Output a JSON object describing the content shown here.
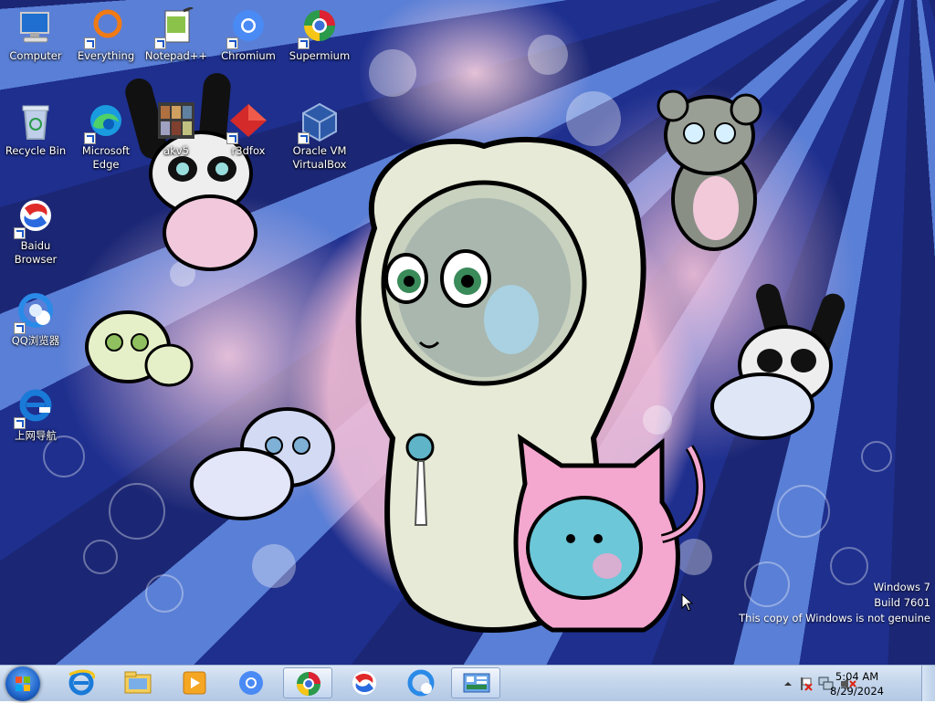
{
  "desktop_icons": [
    {
      "label": "Computer",
      "icon": "computer-icon",
      "shortcut": false
    },
    {
      "label": "Everything",
      "icon": "everything-icon",
      "shortcut": true
    },
    {
      "label": "Notepad++",
      "icon": "notepadpp-icon",
      "shortcut": true
    },
    {
      "label": "Chromium",
      "icon": "chromium-icon",
      "shortcut": true
    },
    {
      "label": "Supermium",
      "icon": "supermium-icon",
      "shortcut": true
    },
    {
      "label": "Recycle Bin",
      "icon": "recycle-bin-icon",
      "shortcut": false
    },
    {
      "label": "Microsoft Edge",
      "icon": "edge-icon",
      "shortcut": true
    },
    {
      "label": "akv5",
      "icon": "akv5-icon",
      "shortcut": false
    },
    {
      "label": "r3dfox",
      "icon": "r3dfox-icon",
      "shortcut": true
    },
    {
      "label": "Oracle VM VirtualBox",
      "icon": "virtualbox-icon",
      "shortcut": true
    },
    {
      "label": "Baidu Browser",
      "icon": "baidu-browser-icon",
      "shortcut": true
    },
    {
      "label": "QQ浏览器",
      "icon": "qq-browser-icon",
      "shortcut": true
    },
    {
      "label": "上网导航",
      "icon": "ie-navigation-icon",
      "shortcut": true
    }
  ],
  "watermark": {
    "line1": "Windows 7",
    "line2": "Build 7601",
    "line3": "This copy of Windows is not genuine"
  },
  "taskbar": {
    "items": [
      "internet-explorer-icon",
      "explorer-folder-icon",
      "media-player-icon",
      "chromium-icon",
      "supermium-icon",
      "baidu-browser-icon",
      "qq-browser-icon",
      "control-panel-icon"
    ],
    "active": [
      "supermium-icon",
      "control-panel-icon"
    ]
  },
  "tray": {
    "icons": [
      "show-hidden-icons-arrow",
      "action-center-flag-icon",
      "network-icon",
      "volume-muted-icon"
    ],
    "time": "5:04 AM",
    "date": "8/29/2024"
  },
  "colors": {
    "taskbar": "#c5d6ec",
    "desktop_blue": "#1a2a86",
    "pink": "#f5bed7"
  }
}
